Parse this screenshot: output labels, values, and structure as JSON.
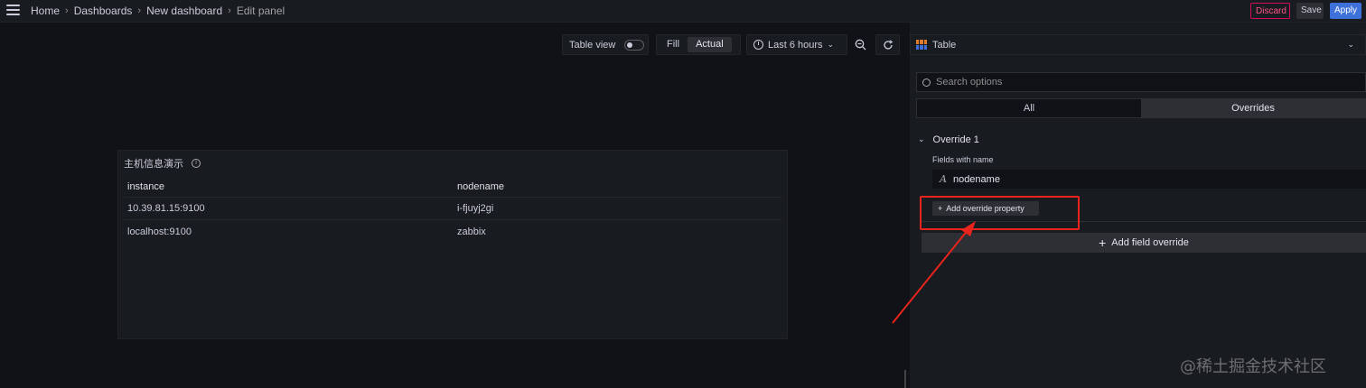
{
  "breadcrumb": {
    "items": [
      "Home",
      "Dashboards",
      "New dashboard"
    ],
    "current": "Edit panel",
    "separator": "›"
  },
  "header_buttons": {
    "discard": "Discard",
    "save": "Save",
    "apply": "Apply"
  },
  "toolbar": {
    "table_view": "Table view",
    "table_view_on": false,
    "fill": "Fill",
    "actual": "Actual",
    "selected_mode": "Actual",
    "time_range": "Last 6 hours"
  },
  "panel": {
    "title": "主机信息演示",
    "columns": [
      "instance",
      "nodename"
    ],
    "rows": [
      [
        "10.39.81.15:9100",
        "i-fjuyj2gi"
      ],
      [
        "localhost:9100",
        "zabbix"
      ]
    ]
  },
  "options": {
    "visualization": "Table",
    "search_placeholder": "Search options",
    "tabs": [
      "All",
      "Overrides"
    ],
    "active_tab": "Overrides",
    "override_title": "Override 1",
    "matcher_label": "Fields with name",
    "matcher_value": "nodename",
    "add_property": "Add override property",
    "add_field_override": "Add field override"
  },
  "watermark": "@稀土掘金技术社区",
  "colors": {
    "accent_blue": "#3d71d9",
    "discard_red": "#d10e5c",
    "annotation_red": "#e8241c"
  }
}
